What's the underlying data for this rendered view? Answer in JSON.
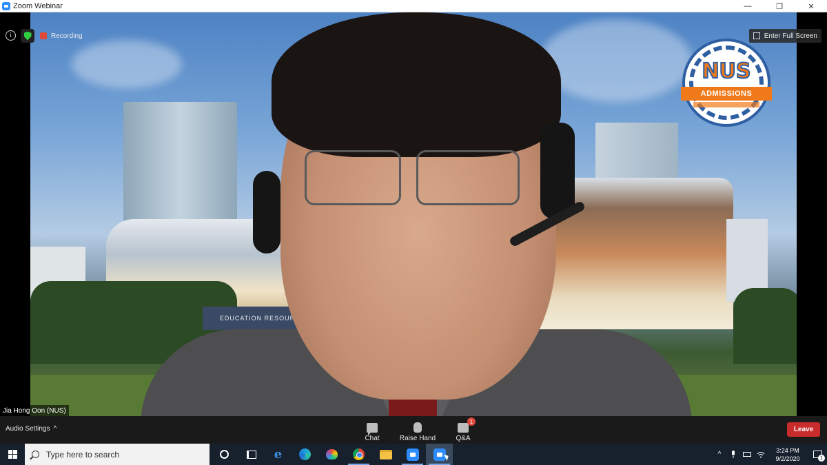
{
  "window": {
    "title": "Zoom Webinar",
    "controls": {
      "minimize": "—",
      "restore": "❐",
      "close": "✕"
    }
  },
  "overlay": {
    "recording_label": "Recording",
    "fullscreen_label": "Enter Full Screen",
    "speaker_name": "Jia Hong Oon (NUS)"
  },
  "background": {
    "sign_text": "EDUCATION RESOURCE CENTRE",
    "logo": {
      "title": "NUS",
      "banner": "ADMISSIONS"
    }
  },
  "toolbar": {
    "audio_settings": "Audio Settings",
    "audio_chevron": "^",
    "chat": "Chat",
    "raise_hand": "Raise Hand",
    "qa": "Q&A",
    "qa_badge": "1",
    "leave": "Leave"
  },
  "taskbar": {
    "search_placeholder": "Type here to search",
    "time": "3:24 PM",
    "date": "9/2/2020",
    "notification_count": "1",
    "tray_chevron": "^"
  },
  "colors": {
    "zoom_blue": "#2d8cff",
    "leave_red": "#c92c2c",
    "badge_red": "#e04a3c",
    "nus_orange": "#f07a1a",
    "nus_blue": "#2f5fa3",
    "taskbar": "#17212e"
  }
}
